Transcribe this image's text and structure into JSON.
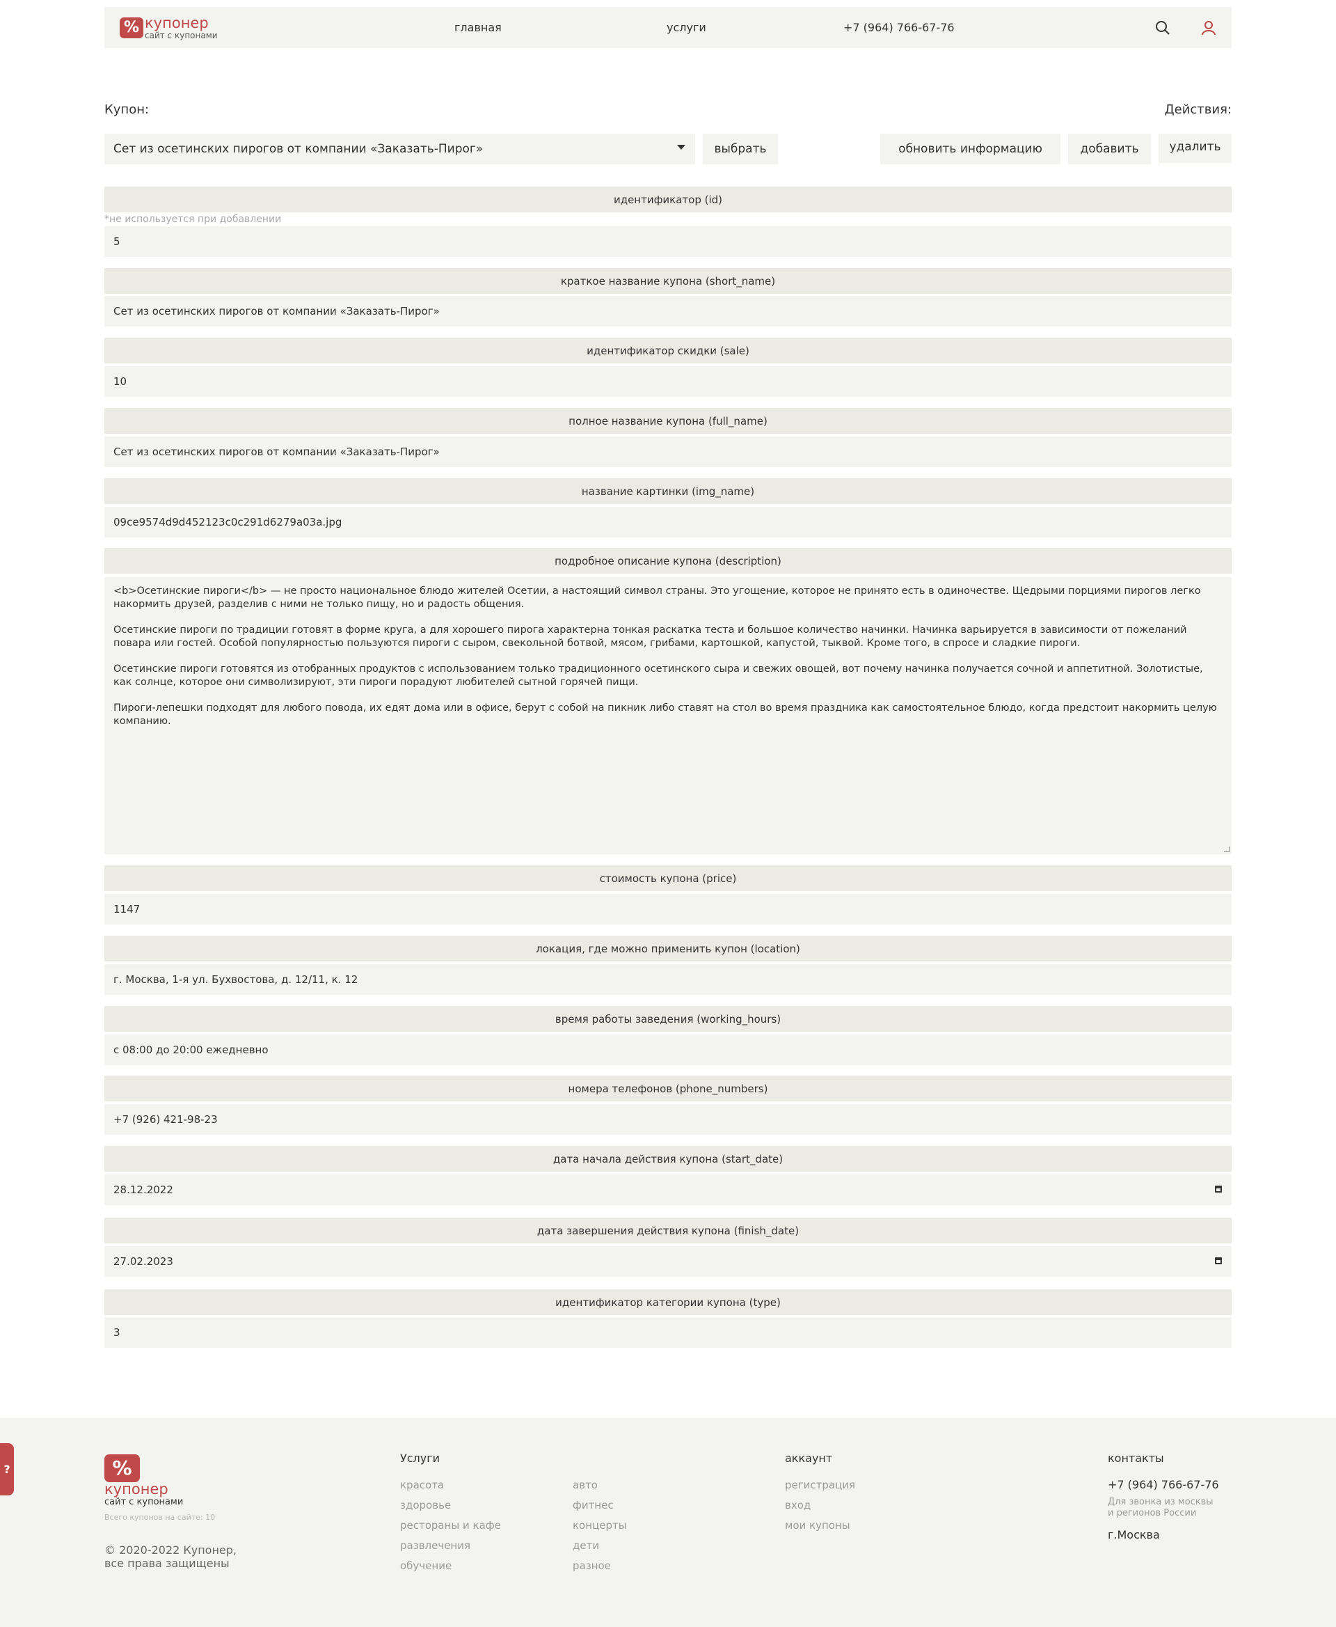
{
  "brand": {
    "name": "купонер",
    "tagline": "сайт с купонами",
    "mark": "%",
    "color": "#c04a4a"
  },
  "header": {
    "nav": [
      "главная",
      "услуги"
    ],
    "phone": "+7 (964) 766-67-76",
    "icons": [
      "search-icon",
      "user-icon"
    ]
  },
  "toolbar": {
    "coupon_label": "Купон:",
    "actions_label": "Действия:",
    "selected_coupon": "Сет из осетинских пирогов от компании «Заказать-Пирог»",
    "choose_button": "выбрать",
    "update_button": "обновить информацию",
    "add_button": "добавить",
    "delete_button": "удалить"
  },
  "fields": {
    "id": {
      "label": "идентификатор (id)",
      "note": "*не используется при добавлении",
      "value": "5"
    },
    "short_name": {
      "label": "краткое название купона (short_name)",
      "value": "Сет из осетинских пирогов от компании «Заказать-Пирог»"
    },
    "sale": {
      "label": "идентификатор скидки (sale)",
      "value": "10"
    },
    "full_name": {
      "label": "полное название купона (full_name)",
      "value": "Сет из осетинских пирогов от компании «Заказать-Пирог»"
    },
    "img_name": {
      "label": "название картинки (img_name)",
      "value": "09ce9574d9d452123c0c291d6279a03a.jpg"
    },
    "description": {
      "label": "подробное описание купона (description)",
      "paragraphs": [
        "<b>Осетинские пироги</b> — не просто национальное блюдо жителей Осетии, а настоящий символ страны. Это угощение, которое не принято есть в одиночестве. Щедрыми порциями пирогов легко накормить друзей, разделив с ними не только пищу, но и радость общения.",
        "Осетинские пироги по традиции готовят в форме круга, а для хорошего пирога характерна тонкая раскатка теста и большое количество начинки. Начинка варьируется в зависимости от пожеланий повара или гостей. Особой популярностью пользуются пироги с сыром, свекольной ботвой, мясом, грибами, картошкой, капустой, тыквой. Кроме того, в спросе и сладкие пироги.",
        "Осетинские пироги готовятся из отобранных продуктов с использованием только традиционного осетинского сыра и свежих овощей, вот почему начинка получается сочной и аппетитной. Золотистые, как солнце, которое они символизируют, эти пироги порадуют любителей сытной горячей пищи.",
        "Пироги-лепешки подходят для любого повода, их едят дома или в офисе, берут с собой на пикник либо ставят на стол во время праздника как самостоятельное блюдо, когда предстоит накормить целую компанию."
      ]
    },
    "price": {
      "label": "стоимость купона (price)",
      "value": "1147"
    },
    "location": {
      "label": "локация, где можно применить купон (location)",
      "value": "г. Москва, 1-я ул. Бухвостова, д. 12/11, к. 12"
    },
    "working_hours": {
      "label": "время работы заведения (working_hours)",
      "value": "с 08:00 до 20:00 ежедневно"
    },
    "phone_numbers": {
      "label": "номера телефонов (phone_numbers)",
      "value": "+7 (926) 421-98-23"
    },
    "start_date": {
      "label": "дата начала действия купона (start_date)",
      "value": "28.12.2022"
    },
    "finish_date": {
      "label": "дата завершения действия купона (finish_date)",
      "value": "27.02.2023"
    },
    "type": {
      "label": "идентификатор категории купона (type)",
      "value": "3"
    }
  },
  "footer": {
    "help": "?",
    "total": "Всего купонов на сайте: 10",
    "copyright_line1": "© 2020-2022 Купонер,",
    "copyright_line2": "все права защищены",
    "services_heading": "Услуги",
    "services_col1": [
      "красота",
      "здоровье",
      "рестораны и кафе",
      "развлечения",
      "обучение"
    ],
    "services_col2": [
      "авто",
      "фитнес",
      "концерты",
      "дети",
      "разное"
    ],
    "account_heading": "аккаунт",
    "account_links": [
      "регистрация",
      "вход",
      "мои купоны"
    ],
    "contacts_heading": "контакты",
    "contacts_phone": "+7 (964) 766-67-76",
    "contacts_note_line1": "Для звонка из москвы",
    "contacts_note_line2": "и регионов России",
    "contacts_city": "г.Москва"
  },
  "colors": {
    "accent": "#c04a4a",
    "panel": "#f3f3ef",
    "field_header": "#ebebe3"
  }
}
